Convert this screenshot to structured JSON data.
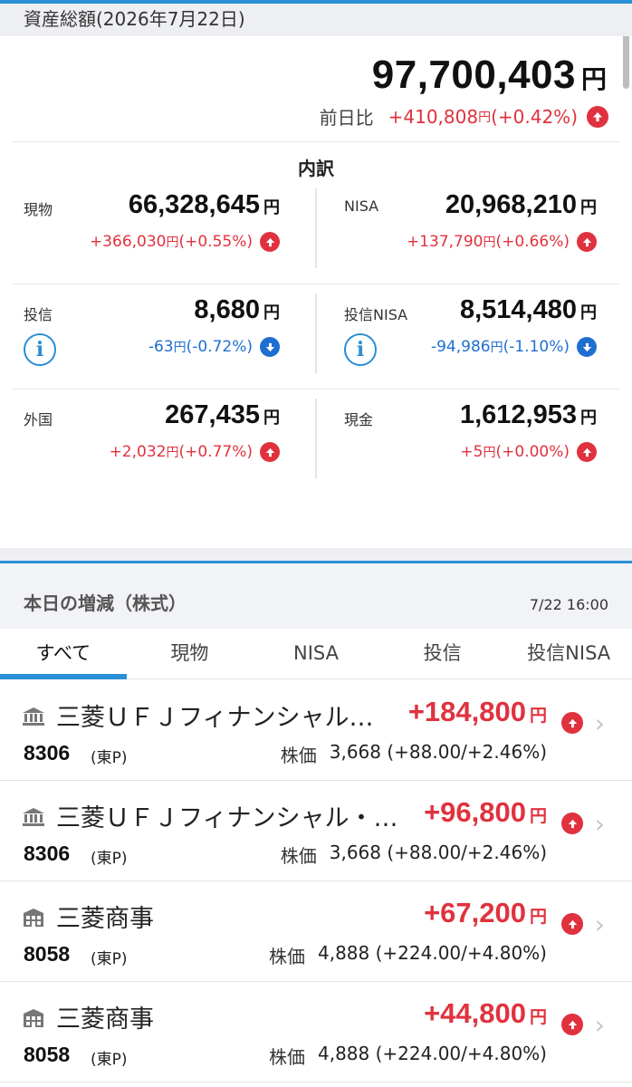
{
  "header": {
    "title": "資産総額(2026年7月22日)"
  },
  "total": {
    "amount": "97,700,403",
    "yen": "円",
    "change_label": "前日比",
    "change": "+410,808",
    "change_yen": "円",
    "change_pct": " (+0.42%)"
  },
  "breakdown": {
    "title": "内訳",
    "cells": [
      {
        "name": "現物",
        "amount": "66,328,645",
        "yen": "円",
        "change": "+366,030",
        "change_yen": "円",
        "pct": "(+0.55%)",
        "direction": "up"
      },
      {
        "name": "NISA",
        "amount": "20,968,210",
        "yen": "円",
        "change": "+137,790",
        "change_yen": "円",
        "pct": "(+0.66%)",
        "direction": "up"
      },
      {
        "name": "投信",
        "amount": "8,680",
        "yen": "円",
        "change": "-63",
        "change_yen": "円",
        "pct": "(-0.72%)",
        "direction": "down"
      },
      {
        "name": "投信NISA",
        "amount": "8,514,480",
        "yen": "円",
        "change": "-94,986",
        "change_yen": "円",
        "pct": "(-1.10%)",
        "direction": "down"
      },
      {
        "name": "外国",
        "amount": "267,435",
        "yen": "円",
        "change": "+2,032",
        "change_yen": "円",
        "pct": "(+0.77%)",
        "direction": "up"
      },
      {
        "name": "現金",
        "amount": "1,612,953",
        "yen": "円",
        "change": "+5",
        "change_yen": "円",
        "pct": "(+0.00%)",
        "direction": "up"
      }
    ]
  },
  "daily": {
    "title": "本日の増減（株式）",
    "timestamp": "7/22 16:00",
    "tabs": [
      "すべて",
      "現物",
      "NISA",
      "投信",
      "投信NISA"
    ],
    "active_tab": "すべて",
    "rows": [
      {
        "name": "三菱ＵＦＪフィナンシャル…",
        "gain": "+184,800",
        "yen": "円",
        "code": "8306",
        "market": "(東P)",
        "price_label": "株価",
        "price": "3,668 (+88.00/+2.46%)"
      },
      {
        "name": "三菱ＵＦＪフィナンシャル・…",
        "gain": "+96,800",
        "yen": "円",
        "code": "8306",
        "market": "(東P)",
        "price_label": "株価",
        "price": "3,668 (+88.00/+2.46%)"
      },
      {
        "name": "三菱商事",
        "gain": "+67,200",
        "yen": "円",
        "code": "8058",
        "market": "(東P)",
        "price_label": "株価",
        "price": "4,888 (+224.00/+4.80%)"
      },
      {
        "name": "三菱商事",
        "gain": "+44,800",
        "yen": "円",
        "code": "8058",
        "market": "(東P)",
        "price_label": "株価",
        "price": "4,888 (+224.00/+4.80%)"
      }
    ]
  },
  "colors": {
    "accent": "#2a8fd4",
    "up": "#e0323e",
    "down": "#1f6fd1"
  },
  "icons": {
    "up": "arrow-up-circle-icon",
    "down": "arrow-down-circle-icon",
    "info": "info-icon",
    "bank": "bank-icon",
    "building": "building-icon",
    "chevron": "chevron-right-icon"
  }
}
